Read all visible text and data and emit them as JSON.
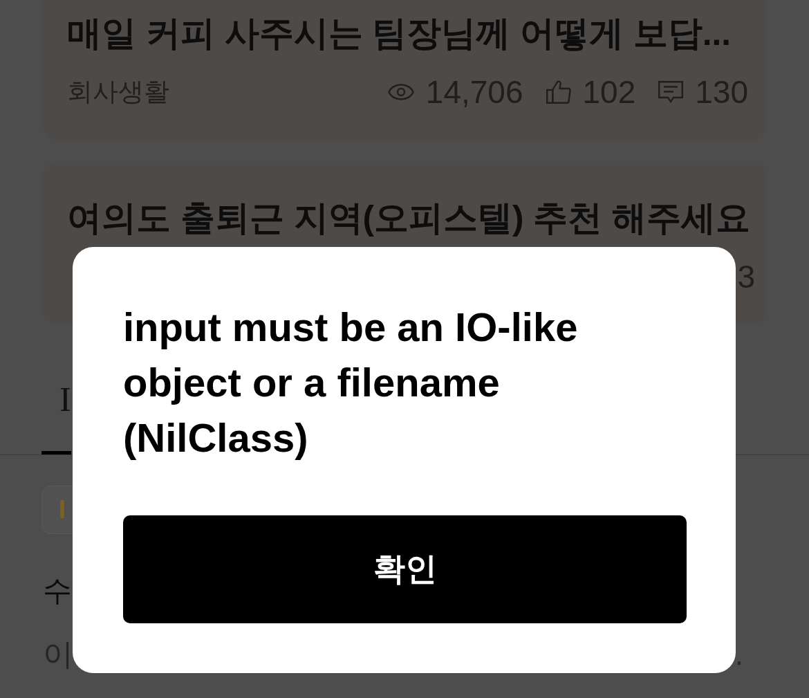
{
  "posts": [
    {
      "title": "매일 커피 사주시는 팀장님께 어떻게 보답...",
      "category": "회사생활",
      "stats": [
        {
          "kind": "views",
          "value": "14,706"
        },
        {
          "kind": "likes",
          "value": "102"
        },
        {
          "kind": "comments",
          "value": "130"
        }
      ]
    },
    {
      "title": "여의도 출퇴근 지역(오피스텔) 추천 해주세요",
      "meta_end": "3"
    }
  ],
  "tabs": [
    {
      "label": "I",
      "selected": true
    }
  ],
  "chips": [
    {
      "label": "I"
    }
  ],
  "section": {
    "heading": "수",
    "description_start": "이",
    "description_end": "."
  },
  "dialog": {
    "message": "input must be an IO-like object or a filename (NilClass)",
    "button": "확인"
  }
}
